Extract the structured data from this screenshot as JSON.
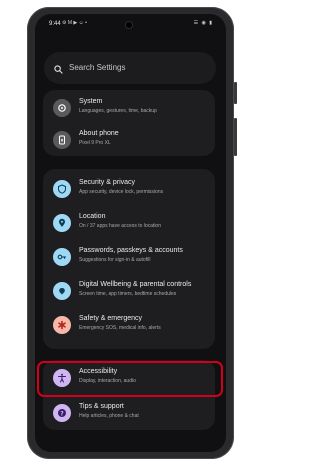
{
  "status_bar": {
    "time": "9:44",
    "left_icons": "⚙ M ▶ ☺ •",
    "right_icons": "☰ ◉ ▮"
  },
  "search": {
    "placeholder": "Search Settings"
  },
  "groups": [
    {
      "items": [
        {
          "title": "System",
          "subtitle": "Languages, gestures, time, backup",
          "icon": "info-icon",
          "icon_color": "#5a5a5e",
          "glyph_color": "#ffffff"
        },
        {
          "title": "About phone",
          "subtitle": "Pixel 9 Pro XL",
          "icon": "phone-icon",
          "icon_color": "#5a5a5e",
          "glyph_color": "#ffffff"
        }
      ]
    },
    {
      "items": [
        {
          "title": "Security & privacy",
          "subtitle": "App security, device lock, permissions",
          "icon": "shield-icon",
          "icon_color": "#9fd8f5",
          "glyph_color": "#0b3c56"
        },
        {
          "title": "Location",
          "subtitle": "On / 37 apps have access to location",
          "icon": "location-pin-icon",
          "icon_color": "#9fd8f5",
          "glyph_color": "#0b3c56"
        },
        {
          "title": "Passwords, passkeys & accounts",
          "subtitle": "Suggestions for sign-in & autofill",
          "icon": "key-icon",
          "icon_color": "#9fd8f5",
          "glyph_color": "#0b3c56"
        },
        {
          "title": "Digital Wellbeing & parental controls",
          "subtitle": "Screen time, app timers, bedtime schedules",
          "icon": "wellbeing-icon",
          "icon_color": "#9fd8f5",
          "glyph_color": "#0b3c56"
        },
        {
          "title": "Safety & emergency",
          "subtitle": "Emergency SOS, medical info, alerts",
          "icon": "emergency-asterisk-icon",
          "icon_color": "#f7b7a9",
          "glyph_color": "#b3261e"
        }
      ]
    },
    {
      "items": [
        {
          "title": "Accessibility",
          "subtitle": "Display, interaction, audio",
          "icon": "accessibility-person-icon",
          "icon_color": "#cfb6f2",
          "glyph_color": "#3a1f66"
        },
        {
          "title": "Tips & support",
          "subtitle": "Help articles, phone & chat",
          "icon": "help-question-icon",
          "icon_color": "#cfb6f2",
          "glyph_color": "#3a1f66"
        }
      ]
    }
  ]
}
